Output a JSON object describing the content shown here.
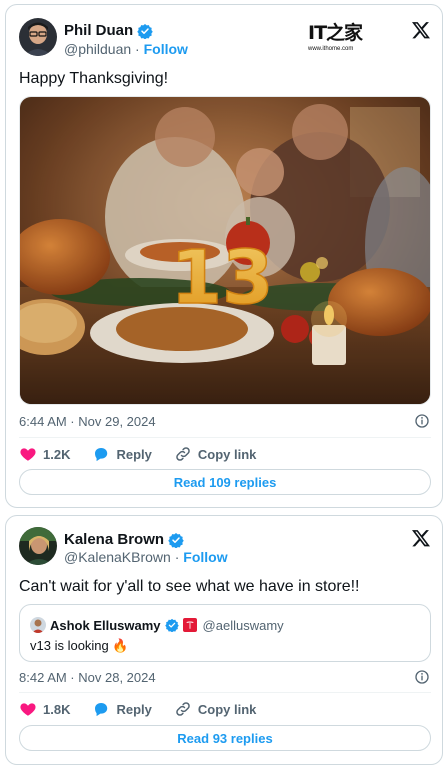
{
  "watermark": {
    "main": "IT之家",
    "sub": "www.ithome.com"
  },
  "tweet1": {
    "author": "Phil Duan",
    "handle": "@philduan",
    "separator": "·",
    "follow_label": "Follow",
    "text": "Happy Thanksgiving!",
    "time": "6:44 AM · Nov 29, 2024",
    "like_count": "1.2K",
    "reply_label": "Reply",
    "copy_label": "Copy link",
    "read_replies": "Read 109 replies",
    "image_number": "13"
  },
  "tweet2": {
    "author": "Kalena Brown",
    "handle": "@KalenaKBrown",
    "separator": "·",
    "follow_label": "Follow",
    "text": "Can't wait for y'all to see what we have in store!!",
    "quote": {
      "author": "Ashok Elluswamy",
      "handle": "@aelluswamy",
      "text": "v13 is looking 🔥"
    },
    "time": "8:42 AM · Nov 28, 2024",
    "like_count": "1.8K",
    "reply_label": "Reply",
    "copy_label": "Copy link",
    "read_replies": "Read 93 replies"
  },
  "colors": {
    "accent": "#1d9bf0",
    "like": "#f91880",
    "muted": "#536471",
    "tesla_red": "#e31937"
  },
  "icons": [
    "verified-badge-icon",
    "x-logo-icon",
    "info-icon",
    "heart-icon",
    "reply-bubble-icon",
    "link-icon",
    "tesla-icon",
    "fire-emoji"
  ]
}
